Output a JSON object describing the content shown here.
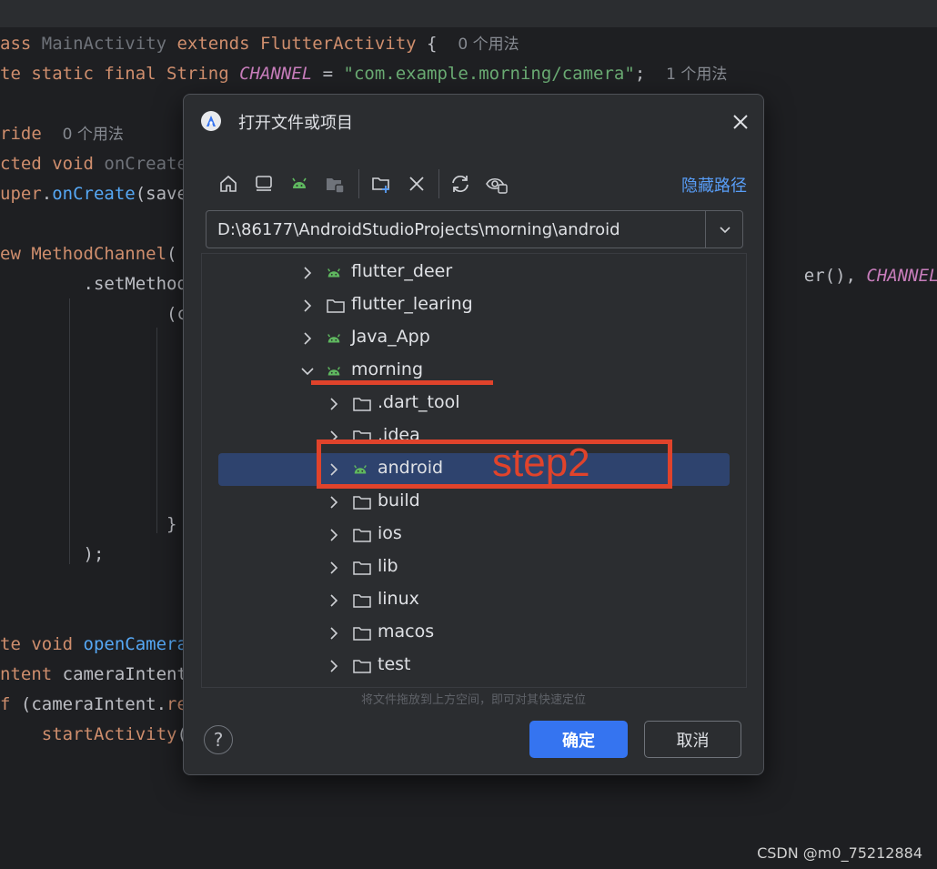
{
  "editor": {
    "lines": [
      [
        {
          "t": "ass ",
          "c": "kw"
        },
        {
          "t": "MainActivity ",
          "c": "dim"
        },
        {
          "t": "extends ",
          "c": "kw"
        },
        {
          "t": "FlutterActivity",
          "c": "cls"
        },
        {
          "t": " {  ",
          "c": ""
        },
        {
          "t": "0 个用法",
          "c": "hint"
        }
      ],
      [
        {
          "t": "te static final ",
          "c": "kw"
        },
        {
          "t": "String ",
          "c": "cls"
        },
        {
          "t": "CHANNEL",
          "c": "const"
        },
        {
          "t": " = ",
          "c": ""
        },
        {
          "t": "\"com.example.morning/camera\"",
          "c": "str"
        },
        {
          "t": ";  ",
          "c": ""
        },
        {
          "t": "1 个用法",
          "c": "hint"
        }
      ],
      [],
      [
        {
          "t": "ride  ",
          "c": "kw"
        },
        {
          "t": "0 个用法",
          "c": "hint"
        }
      ],
      [
        {
          "t": "cted void ",
          "c": "kw"
        },
        {
          "t": "onCreate",
          "c": "dim"
        }
      ],
      [
        {
          "t": "uper",
          "c": "kw"
        },
        {
          "t": ".",
          "c": ""
        },
        {
          "t": "onCreate",
          "c": "fn"
        },
        {
          "t": "(save",
          "c": ""
        }
      ],
      [],
      [
        {
          "t": "ew ",
          "c": "kw"
        },
        {
          "t": "MethodChannel",
          "c": "cls"
        },
        {
          "t": "(",
          "c": ""
        }
      ],
      [
        {
          "t": "        .setMethod(",
          "c": ""
        }
      ],
      [
        {
          "t": "                (ca",
          "c": ""
        }
      ],
      [],
      [],
      [],
      [],
      [],
      [],
      [
        {
          "t": "                }",
          "c": ""
        }
      ],
      [
        {
          "t": "        );",
          "c": ""
        }
      ],
      [],
      [],
      [
        {
          "t": "te void ",
          "c": "kw"
        },
        {
          "t": "openCamera",
          "c": "fn"
        }
      ],
      [
        {
          "t": "ntent ",
          "c": "kw"
        },
        {
          "t": "cameraIntent",
          "c": ""
        }
      ],
      [
        {
          "t": "f ",
          "c": "kw"
        },
        {
          "t": "(cameraIntent.",
          "c": ""
        },
        {
          "t": "re",
          "c": "kw"
        }
      ],
      [
        {
          "t": "    startActivity",
          "c": "kw"
        },
        {
          "t": "(c",
          "c": ""
        }
      ]
    ],
    "right_fragment": "er(), ",
    "right_const": "CHANNEL",
    "right_close": ")"
  },
  "dialog": {
    "title": "打开文件或项目",
    "hide_path_link": "隐藏路径",
    "path_value": "D:\\86177\\AndroidStudioProjects\\morning\\android",
    "tree": [
      {
        "label": "flutter_deer",
        "icon": "android",
        "expanded": false,
        "depth": 0
      },
      {
        "label": "flutter_learing",
        "icon": "folder",
        "expanded": false,
        "depth": 0
      },
      {
        "label": "Java_App",
        "icon": "android",
        "expanded": false,
        "depth": 0
      },
      {
        "label": "morning",
        "icon": "android",
        "expanded": true,
        "depth": 0
      },
      {
        "label": ".dart_tool",
        "icon": "folder",
        "expanded": false,
        "depth": 1
      },
      {
        "label": ".idea",
        "icon": "folder",
        "expanded": false,
        "depth": 1
      },
      {
        "label": "android",
        "icon": "android",
        "expanded": false,
        "depth": 1,
        "selected": true
      },
      {
        "label": "build",
        "icon": "folder",
        "expanded": false,
        "depth": 1
      },
      {
        "label": "ios",
        "icon": "folder",
        "expanded": false,
        "depth": 1
      },
      {
        "label": "lib",
        "icon": "folder",
        "expanded": false,
        "depth": 1
      },
      {
        "label": "linux",
        "icon": "folder",
        "expanded": false,
        "depth": 1
      },
      {
        "label": "macos",
        "icon": "folder",
        "expanded": false,
        "depth": 1
      },
      {
        "label": "test",
        "icon": "folder",
        "expanded": false,
        "depth": 1
      }
    ],
    "drop_hint": "将文件拖放到上方空间，即可对其快速定位",
    "help_label": "?",
    "ok_label": "确定",
    "cancel_label": "取消",
    "toolbar_icons": [
      "home-icon",
      "desktop-icon",
      "android-project-icon",
      "module-folder-icon",
      "new-folder-icon",
      "delete-icon",
      "refresh-icon",
      "show-hidden-icon"
    ]
  },
  "annotation": {
    "step_label": "step2",
    "color": "#e0432b"
  },
  "watermark": "CSDN @m0_75212884",
  "colors": {
    "accent": "#3574f0",
    "selection": "#2e436e",
    "android_green": "#5fb85f"
  }
}
